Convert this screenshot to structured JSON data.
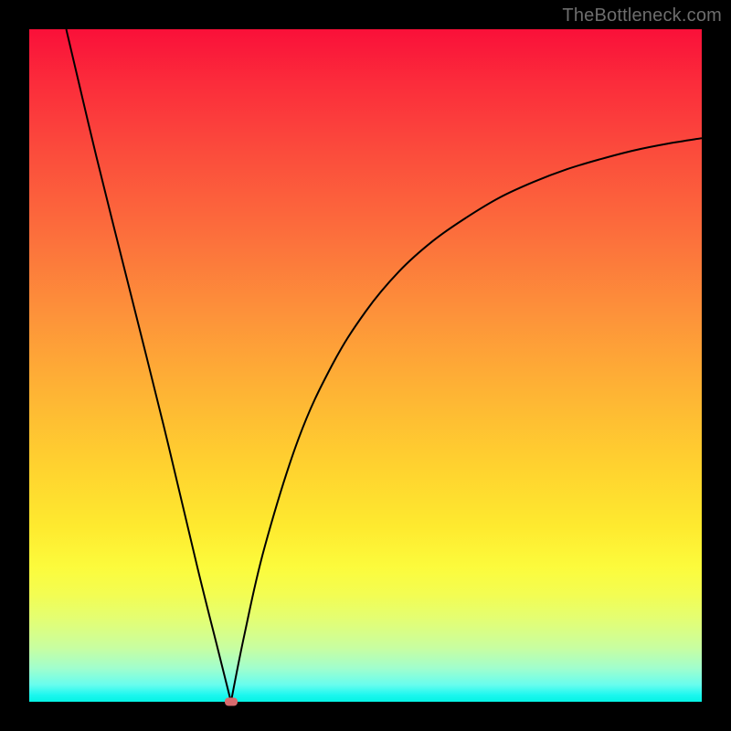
{
  "watermark": {
    "text": "TheBottleneck.com"
  },
  "chart_data": {
    "type": "line",
    "title": "",
    "xlabel": "",
    "ylabel": "",
    "xlim": [
      0,
      100
    ],
    "ylim": [
      0,
      100
    ],
    "grid": false,
    "legend": false,
    "background_gradient": {
      "orientation": "vertical",
      "stops": [
        {
          "pos": 0.0,
          "color": "#fa1039"
        },
        {
          "pos": 0.18,
          "color": "#fb4b3c"
        },
        {
          "pos": 0.42,
          "color": "#fd913a"
        },
        {
          "pos": 0.65,
          "color": "#ffd22f"
        },
        {
          "pos": 0.8,
          "color": "#fcfb3c"
        },
        {
          "pos": 0.92,
          "color": "#c8fea1"
        },
        {
          "pos": 1.0,
          "color": "#04f3e4"
        }
      ]
    },
    "series": [
      {
        "name": "curve-left",
        "x": [
          5.5,
          10,
          15,
          20,
          25,
          28,
          30
        ],
        "y": [
          100,
          81,
          61,
          41,
          20,
          8,
          0
        ],
        "stroke": "#000000",
        "width": 2
      },
      {
        "name": "curve-right",
        "x": [
          30,
          32,
          35,
          40,
          45,
          50,
          55,
          60,
          65,
          70,
          75,
          80,
          85,
          90,
          95,
          100
        ],
        "y": [
          0,
          10,
          23,
          39,
          50,
          58,
          64,
          68.5,
          72,
          75,
          77.3,
          79.2,
          80.7,
          82,
          83,
          83.8
        ],
        "stroke": "#000000",
        "width": 2
      }
    ],
    "markers": [
      {
        "name": "bottleneck-marker",
        "x": 30,
        "y": 0,
        "color": "#d76b6e",
        "shape": "rounded-rect"
      }
    ]
  },
  "colors": {
    "frame": "#000000",
    "curve": "#000000",
    "marker": "#d76b6e",
    "watermark": "#6d6d6d"
  }
}
